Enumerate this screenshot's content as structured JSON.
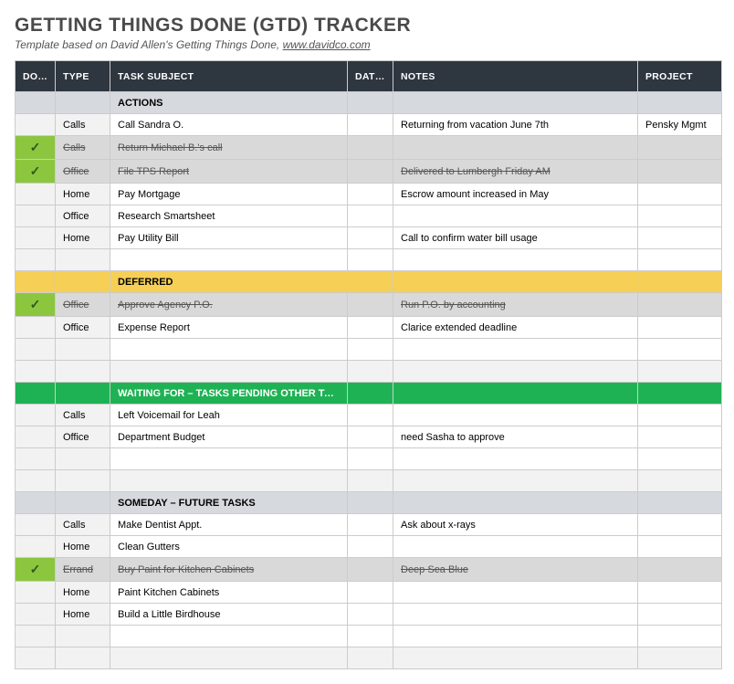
{
  "title": "GETTING THINGS DONE (GTD) TRACKER",
  "subtitle_prefix": "Template based on David Allen's Getting Things Done,  ",
  "subtitle_link": "www.davidco.com",
  "columns": {
    "done": "DONE",
    "type": "TYPE",
    "subject": "TASK SUBJECT",
    "due": "DATE DUE",
    "notes": "NOTES",
    "project": "PROJECT"
  },
  "check_glyph": "✓",
  "rows": [
    {
      "kind": "section",
      "style": "grey",
      "subject": "ACTIONS"
    },
    {
      "kind": "task",
      "done": false,
      "type": "Calls",
      "subject": "Call Sandra O.",
      "due": "",
      "notes": "Returning from vacation June 7th",
      "project": "Pensky Mgmt"
    },
    {
      "kind": "task",
      "done": true,
      "type": "Calls",
      "subject": "Return Michael B.'s call",
      "due": "",
      "notes": "",
      "project": ""
    },
    {
      "kind": "task",
      "done": true,
      "type": "Office",
      "subject": "File TPS Report",
      "due": "",
      "notes": "Delivered to Lumbergh Friday AM",
      "project": ""
    },
    {
      "kind": "task",
      "done": false,
      "type": "Home",
      "subject": "Pay Mortgage",
      "due": "",
      "notes": "Escrow amount increased in May",
      "project": ""
    },
    {
      "kind": "task",
      "done": false,
      "type": "Office",
      "subject": "Research Smartsheet",
      "due": "",
      "notes": "",
      "project": ""
    },
    {
      "kind": "task",
      "done": false,
      "type": "Home",
      "subject": "Pay Utility Bill",
      "due": "",
      "notes": "Call to confirm water bill usage",
      "project": ""
    },
    {
      "kind": "blank"
    },
    {
      "kind": "section",
      "style": "yellow",
      "subject": "DEFERRED"
    },
    {
      "kind": "task",
      "done": true,
      "type": "Office",
      "subject": "Approve Agency P.O.",
      "due": "",
      "notes": "Run P.O. by accounting",
      "project": ""
    },
    {
      "kind": "task",
      "done": false,
      "type": "Office",
      "subject": "Expense Report",
      "due": "",
      "notes": "Clarice extended deadline",
      "project": ""
    },
    {
      "kind": "blank"
    },
    {
      "kind": "blank2"
    },
    {
      "kind": "section",
      "style": "green",
      "subject": "WAITING FOR – TASKS PENDING OTHER TASKS"
    },
    {
      "kind": "task",
      "done": false,
      "type": "Calls",
      "subject": "Left Voicemail for Leah",
      "due": "",
      "notes": "",
      "project": ""
    },
    {
      "kind": "task",
      "done": false,
      "type": "Office",
      "subject": "Department Budget",
      "due": "",
      "notes": "need Sasha to approve",
      "project": ""
    },
    {
      "kind": "blank"
    },
    {
      "kind": "blank2"
    },
    {
      "kind": "section",
      "style": "grey",
      "subject": "SOMEDAY – FUTURE TASKS"
    },
    {
      "kind": "task",
      "done": false,
      "type": "Calls",
      "subject": "Make Dentist Appt.",
      "due": "",
      "notes": "Ask about x-rays",
      "project": ""
    },
    {
      "kind": "task",
      "done": false,
      "type": "Home",
      "subject": "Clean Gutters",
      "due": "",
      "notes": "",
      "project": ""
    },
    {
      "kind": "task",
      "done": true,
      "type": "Errand",
      "subject": "Buy Paint for Kitchen Cabinets",
      "due": "",
      "notes": "Deep Sea Blue",
      "project": ""
    },
    {
      "kind": "task",
      "done": false,
      "type": "Home",
      "subject": "Paint Kitchen Cabinets",
      "due": "",
      "notes": "",
      "project": ""
    },
    {
      "kind": "task",
      "done": false,
      "type": "Home",
      "subject": "Build a Little Birdhouse",
      "due": "",
      "notes": "",
      "project": ""
    },
    {
      "kind": "blank"
    },
    {
      "kind": "blank2"
    }
  ]
}
